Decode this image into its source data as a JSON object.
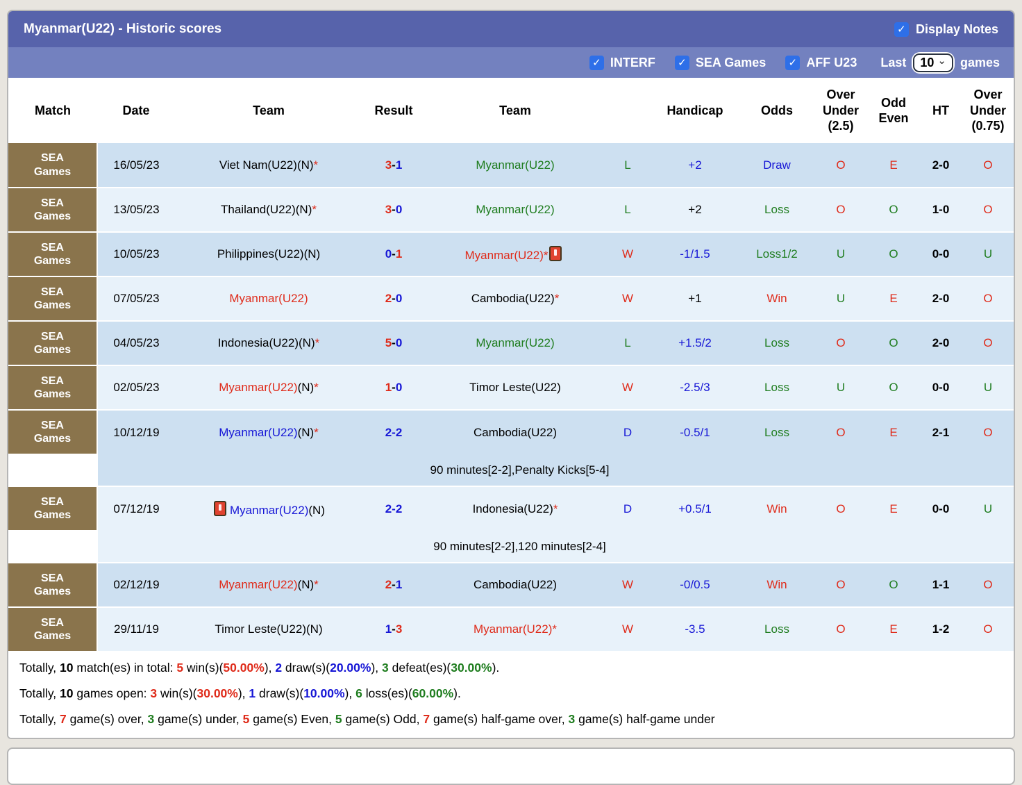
{
  "title": "Myanmar(U22) - Historic scores",
  "display_notes": {
    "label": "Display Notes",
    "checked": true
  },
  "filters": {
    "checkboxes": [
      {
        "id": "interf",
        "label": "INTERF",
        "checked": true
      },
      {
        "id": "sea-games",
        "label": "SEA Games",
        "checked": true
      },
      {
        "id": "aff-u23",
        "label": "AFF U23",
        "checked": true
      }
    ],
    "last_label": "Last",
    "games_count": "10",
    "games_label": "games"
  },
  "icons": {
    "checkmark": "✓",
    "chevron_down": "⌄",
    "red_card": "red-card-shape"
  },
  "colors": {
    "red": "#df2b1a",
    "green": "#1f7d1f",
    "blue": "#1717d6",
    "black": "#000000",
    "brown": "#8a744c",
    "row_dark": "#cde0f1",
    "row_light": "#e8f2fa",
    "title_bar": "#5763ab",
    "filter_bar": "#7381bf",
    "checkbox_blue": "#2e6fe8"
  },
  "table": {
    "headers": [
      {
        "key": "match",
        "label": "Match"
      },
      {
        "key": "date",
        "label": "Date"
      },
      {
        "key": "team1",
        "label": "Team"
      },
      {
        "key": "result",
        "label": "Result"
      },
      {
        "key": "team2",
        "label": "Team"
      },
      {
        "key": "letter",
        "label": ""
      },
      {
        "key": "handicap",
        "label": "Handicap"
      },
      {
        "key": "odds",
        "label": "Odds"
      },
      {
        "key": "ou25",
        "label": "Over Under (2.5)"
      },
      {
        "key": "oddeven",
        "label": "Odd Even"
      },
      {
        "key": "ht",
        "label": "HT"
      },
      {
        "key": "ou075",
        "label": "Over Under (0.75)"
      }
    ],
    "rows": [
      {
        "shade": "dark",
        "match": "SEA Games",
        "date": "16/05/23",
        "team1": {
          "name": "Viet Nam(U22)",
          "suffix": "(N)",
          "star": true,
          "color": "black"
        },
        "result": {
          "left": "3",
          "left_color": "red",
          "right": "1",
          "right_color": "blue"
        },
        "team2": {
          "name": "Myanmar(U22)",
          "suffix": "",
          "star": false,
          "color": "green"
        },
        "letter": {
          "text": "L",
          "color": "green"
        },
        "handicap": {
          "text": "+2",
          "color": "blue"
        },
        "odds": {
          "text": "Draw",
          "color": "blue"
        },
        "ou25": {
          "text": "O",
          "color": "red"
        },
        "oddeven": {
          "text": "E",
          "color": "red"
        },
        "ht": "2-0",
        "ou075": {
          "text": "O",
          "color": "red"
        },
        "note": null
      },
      {
        "shade": "light",
        "match": "SEA Games",
        "date": "13/05/23",
        "team1": {
          "name": "Thailand(U22)",
          "suffix": "(N)",
          "star": true,
          "color": "black"
        },
        "result": {
          "left": "3",
          "left_color": "red",
          "right": "0",
          "right_color": "blue"
        },
        "team2": {
          "name": "Myanmar(U22)",
          "suffix": "",
          "star": false,
          "color": "green"
        },
        "letter": {
          "text": "L",
          "color": "green"
        },
        "handicap": {
          "text": "+2",
          "color": "black"
        },
        "odds": {
          "text": "Loss",
          "color": "green"
        },
        "ou25": {
          "text": "O",
          "color": "red"
        },
        "oddeven": {
          "text": "O",
          "color": "green"
        },
        "ht": "1-0",
        "ou075": {
          "text": "O",
          "color": "red"
        },
        "note": null
      },
      {
        "shade": "dark",
        "match": "SEA Games",
        "date": "10/05/23",
        "team1": {
          "name": "Philippines(U22)",
          "suffix": "(N)",
          "star": false,
          "color": "black"
        },
        "result": {
          "left": "0",
          "left_color": "blue",
          "right": "1",
          "right_color": "red"
        },
        "team2": {
          "name": "Myanmar(U22)",
          "suffix": "",
          "star": true,
          "color": "red",
          "red_card_after": true
        },
        "letter": {
          "text": "W",
          "color": "red"
        },
        "handicap": {
          "text": "-1/1.5",
          "color": "blue"
        },
        "odds": {
          "text": "Loss1/2",
          "color": "green"
        },
        "ou25": {
          "text": "U",
          "color": "green"
        },
        "oddeven": {
          "text": "O",
          "color": "green"
        },
        "ht": "0-0",
        "ou075": {
          "text": "U",
          "color": "green"
        },
        "note": null
      },
      {
        "shade": "light",
        "match": "SEA Games",
        "date": "07/05/23",
        "team1": {
          "name": "Myanmar(U22)",
          "suffix": "",
          "star": false,
          "color": "red"
        },
        "result": {
          "left": "2",
          "left_color": "red",
          "right": "0",
          "right_color": "blue"
        },
        "team2": {
          "name": "Cambodia(U22)",
          "suffix": "",
          "star": true,
          "color": "black"
        },
        "letter": {
          "text": "W",
          "color": "red"
        },
        "handicap": {
          "text": "+1",
          "color": "black"
        },
        "odds": {
          "text": "Win",
          "color": "red"
        },
        "ou25": {
          "text": "U",
          "color": "green"
        },
        "oddeven": {
          "text": "E",
          "color": "red"
        },
        "ht": "2-0",
        "ou075": {
          "text": "O",
          "color": "red"
        },
        "note": null
      },
      {
        "shade": "dark",
        "match": "SEA Games",
        "date": "04/05/23",
        "team1": {
          "name": "Indonesia(U22)",
          "suffix": "(N)",
          "star": true,
          "color": "black"
        },
        "result": {
          "left": "5",
          "left_color": "red",
          "right": "0",
          "right_color": "blue"
        },
        "team2": {
          "name": "Myanmar(U22)",
          "suffix": "",
          "star": false,
          "color": "green"
        },
        "letter": {
          "text": "L",
          "color": "green"
        },
        "handicap": {
          "text": "+1.5/2",
          "color": "blue"
        },
        "odds": {
          "text": "Loss",
          "color": "green"
        },
        "ou25": {
          "text": "O",
          "color": "red"
        },
        "oddeven": {
          "text": "O",
          "color": "green"
        },
        "ht": "2-0",
        "ou075": {
          "text": "O",
          "color": "red"
        },
        "note": null
      },
      {
        "shade": "light",
        "match": "SEA Games",
        "date": "02/05/23",
        "team1": {
          "name": "Myanmar(U22)",
          "suffix": "(N)",
          "star": true,
          "color": "red"
        },
        "result": {
          "left": "1",
          "left_color": "red",
          "right": "0",
          "right_color": "blue"
        },
        "team2": {
          "name": "Timor Leste(U22)",
          "suffix": "",
          "star": false,
          "color": "black"
        },
        "letter": {
          "text": "W",
          "color": "red"
        },
        "handicap": {
          "text": "-2.5/3",
          "color": "blue"
        },
        "odds": {
          "text": "Loss",
          "color": "green"
        },
        "ou25": {
          "text": "U",
          "color": "green"
        },
        "oddeven": {
          "text": "O",
          "color": "green"
        },
        "ht": "0-0",
        "ou075": {
          "text": "U",
          "color": "green"
        },
        "note": null
      },
      {
        "shade": "dark",
        "match": "SEA Games",
        "date": "10/12/19",
        "team1": {
          "name": "Myanmar(U22)",
          "suffix": "(N)",
          "star": true,
          "color": "blue"
        },
        "result": {
          "left": "2",
          "left_color": "blue",
          "right": "2",
          "right_color": "blue"
        },
        "team2": {
          "name": "Cambodia(U22)",
          "suffix": "",
          "star": false,
          "color": "black"
        },
        "letter": {
          "text": "D",
          "color": "blue"
        },
        "handicap": {
          "text": "-0.5/1",
          "color": "blue"
        },
        "odds": {
          "text": "Loss",
          "color": "green"
        },
        "ou25": {
          "text": "O",
          "color": "red"
        },
        "oddeven": {
          "text": "E",
          "color": "red"
        },
        "ht": "2-1",
        "ou075": {
          "text": "O",
          "color": "red"
        },
        "note": "90 minutes[2-2],Penalty Kicks[5-4]"
      },
      {
        "shade": "light",
        "match": "SEA Games",
        "date": "07/12/19",
        "team1": {
          "name": "Myanmar(U22)",
          "suffix": "(N)",
          "star": false,
          "color": "blue",
          "red_card_before": true
        },
        "result": {
          "left": "2",
          "left_color": "blue",
          "right": "2",
          "right_color": "blue"
        },
        "team2": {
          "name": "Indonesia(U22)",
          "suffix": "",
          "star": true,
          "color": "black"
        },
        "letter": {
          "text": "D",
          "color": "blue"
        },
        "handicap": {
          "text": "+0.5/1",
          "color": "blue"
        },
        "odds": {
          "text": "Win",
          "color": "red"
        },
        "ou25": {
          "text": "O",
          "color": "red"
        },
        "oddeven": {
          "text": "E",
          "color": "red"
        },
        "ht": "0-0",
        "ou075": {
          "text": "U",
          "color": "green"
        },
        "note": "90 minutes[2-2],120 minutes[2-4]"
      },
      {
        "shade": "dark",
        "match": "SEA Games",
        "date": "02/12/19",
        "team1": {
          "name": "Myanmar(U22)",
          "suffix": "(N)",
          "star": true,
          "color": "red"
        },
        "result": {
          "left": "2",
          "left_color": "red",
          "right": "1",
          "right_color": "blue"
        },
        "team2": {
          "name": "Cambodia(U22)",
          "suffix": "",
          "star": false,
          "color": "black"
        },
        "letter": {
          "text": "W",
          "color": "red"
        },
        "handicap": {
          "text": "-0/0.5",
          "color": "blue"
        },
        "odds": {
          "text": "Win",
          "color": "red"
        },
        "ou25": {
          "text": "O",
          "color": "red"
        },
        "oddeven": {
          "text": "O",
          "color": "green"
        },
        "ht": "1-1",
        "ou075": {
          "text": "O",
          "color": "red"
        },
        "note": null
      },
      {
        "shade": "light",
        "match": "SEA Games",
        "date": "29/11/19",
        "team1": {
          "name": "Timor Leste(U22)",
          "suffix": "(N)",
          "star": false,
          "color": "black"
        },
        "result": {
          "left": "1",
          "left_color": "blue",
          "right": "3",
          "right_color": "red"
        },
        "team2": {
          "name": "Myanmar(U22)",
          "suffix": "",
          "star": true,
          "color": "red"
        },
        "letter": {
          "text": "W",
          "color": "red"
        },
        "handicap": {
          "text": "-3.5",
          "color": "blue"
        },
        "odds": {
          "text": "Loss",
          "color": "green"
        },
        "ou25": {
          "text": "O",
          "color": "red"
        },
        "oddeven": {
          "text": "E",
          "color": "red"
        },
        "ht": "1-2",
        "ou075": {
          "text": "O",
          "color": "red"
        },
        "note": null
      }
    ]
  },
  "summary": [
    [
      {
        "t": "Totally, "
      },
      {
        "t": "10",
        "b": true
      },
      {
        "t": " match(es) in total: "
      },
      {
        "t": "5",
        "c": "red",
        "b": true
      },
      {
        "t": " win(s)("
      },
      {
        "t": "50.00%",
        "c": "red",
        "b": true
      },
      {
        "t": "), "
      },
      {
        "t": "2",
        "c": "blue",
        "b": true
      },
      {
        "t": " draw(s)("
      },
      {
        "t": "20.00%",
        "c": "blue",
        "b": true
      },
      {
        "t": "), "
      },
      {
        "t": "3",
        "c": "green",
        "b": true
      },
      {
        "t": " defeat(es)("
      },
      {
        "t": "30.00%",
        "c": "green",
        "b": true
      },
      {
        "t": ")."
      }
    ],
    [
      {
        "t": "Totally, "
      },
      {
        "t": "10",
        "b": true
      },
      {
        "t": " games open: "
      },
      {
        "t": "3",
        "c": "red",
        "b": true
      },
      {
        "t": " win(s)("
      },
      {
        "t": "30.00%",
        "c": "red",
        "b": true
      },
      {
        "t": "), "
      },
      {
        "t": "1",
        "c": "blue",
        "b": true
      },
      {
        "t": " draw(s)("
      },
      {
        "t": "10.00%",
        "c": "blue",
        "b": true
      },
      {
        "t": "), "
      },
      {
        "t": "6",
        "c": "green",
        "b": true
      },
      {
        "t": " loss(es)("
      },
      {
        "t": "60.00%",
        "c": "green",
        "b": true
      },
      {
        "t": ")."
      }
    ],
    [
      {
        "t": "Totally, "
      },
      {
        "t": "7",
        "c": "red",
        "b": true
      },
      {
        "t": " game(s) over, "
      },
      {
        "t": "3",
        "c": "green",
        "b": true
      },
      {
        "t": " game(s) under, "
      },
      {
        "t": "5",
        "c": "red",
        "b": true
      },
      {
        "t": " game(s) Even, "
      },
      {
        "t": "5",
        "c": "green",
        "b": true
      },
      {
        "t": " game(s) Odd, "
      },
      {
        "t": "7",
        "c": "red",
        "b": true
      },
      {
        "t": " game(s) half-game over, "
      },
      {
        "t": "3",
        "c": "green",
        "b": true
      },
      {
        "t": " game(s) half-game under"
      }
    ]
  ]
}
